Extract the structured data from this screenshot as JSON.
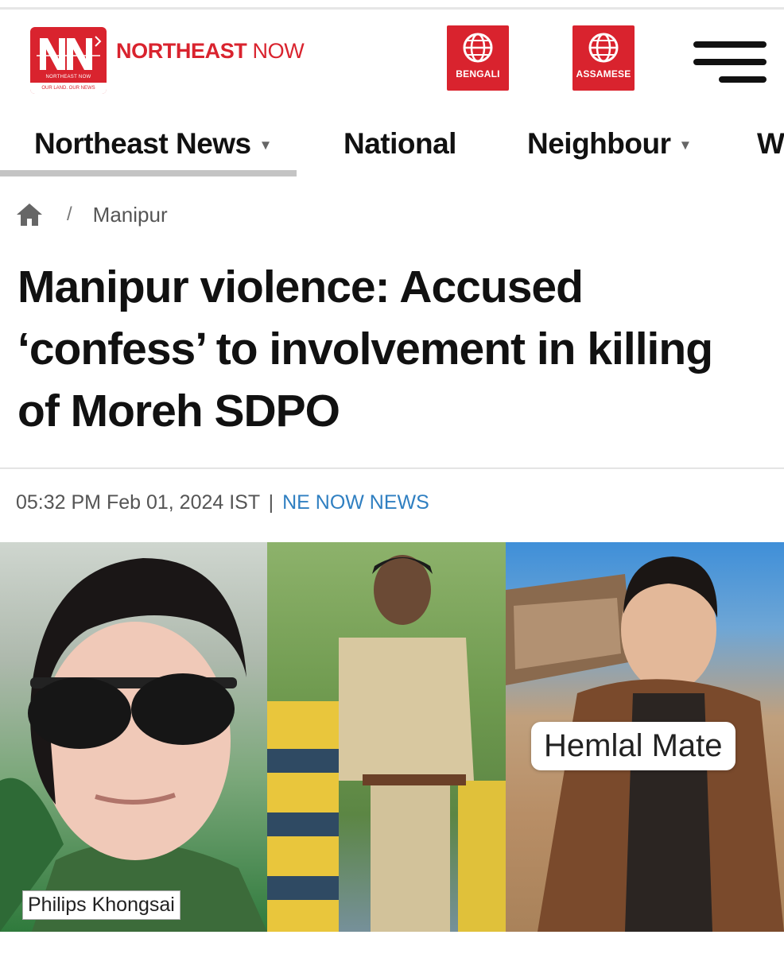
{
  "header": {
    "brand_bold": "NORTHEAST",
    "brand_light": "NOW",
    "logo_small_text": "NORTHEAST NOW",
    "logo_tagline": "OUR LAND. OUR NEWS",
    "lang_bengali": "BENGALI",
    "lang_assamese": "ASSAMESE",
    "brand_color": "#d9232e"
  },
  "nav": {
    "items": [
      {
        "label": "Northeast News",
        "has_dropdown": true,
        "active": true
      },
      {
        "label": "National",
        "has_dropdown": false,
        "active": false
      },
      {
        "label": "Neighbour",
        "has_dropdown": true,
        "active": false
      },
      {
        "label": "W",
        "has_dropdown": false,
        "active": false
      }
    ]
  },
  "breadcrumb": {
    "separator": "/",
    "category": "Manipur"
  },
  "article": {
    "headline": "Manipur violence: Accused ‘confess’ to involvement in killing of Moreh SDPO",
    "timestamp": "05:32 PM Feb 01, 2024 IST",
    "meta_separator": "|",
    "source": "NE NOW NEWS",
    "source_color": "#2f7fc1"
  },
  "photo": {
    "caption_left": "Philips Khongsai",
    "caption_right": "Hemlal Mate"
  }
}
